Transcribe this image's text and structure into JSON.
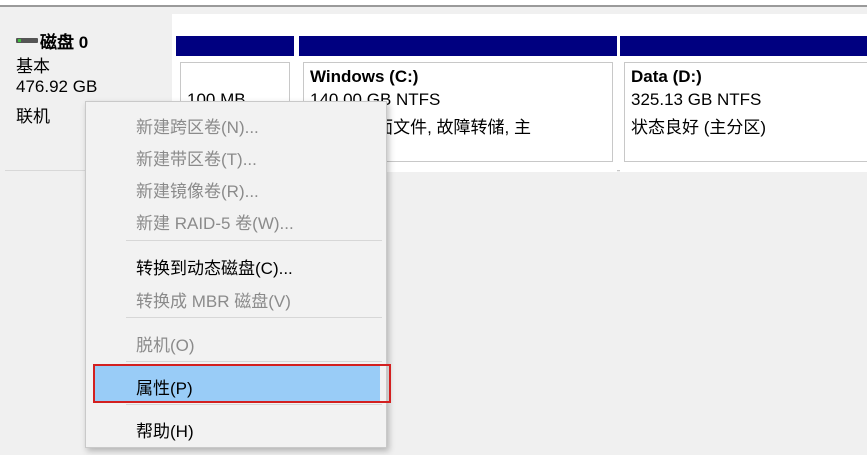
{
  "disk": {
    "title": "磁盘 0",
    "type": "基本",
    "size": "476.92 GB",
    "status": "联机"
  },
  "partitions": [
    {
      "id": "system",
      "size": "100 MB",
      "name": "",
      "fs": "",
      "status": ""
    },
    {
      "id": "windows",
      "name": "Windows  (C:)",
      "fs": "140.00 GB NTFS",
      "status": "(启动, 页面文件, 故障转储, 主"
    },
    {
      "id": "data",
      "name": "Data  (D:)",
      "fs": "325.13 GB NTFS",
      "status": "状态良好 (主分区)"
    }
  ],
  "menu": {
    "items": [
      {
        "label": "新建跨区卷(N)...",
        "enabled": false
      },
      {
        "label": "新建带区卷(T)...",
        "enabled": false
      },
      {
        "label": "新建镜像卷(R)...",
        "enabled": false
      },
      {
        "label": "新建 RAID-5 卷(W)...",
        "enabled": false
      },
      {
        "label": "转换到动态磁盘(C)...",
        "enabled": true
      },
      {
        "label": "转换成 MBR 磁盘(V)",
        "enabled": false
      },
      {
        "label": "脱机(O)",
        "enabled": false
      },
      {
        "label": "属性(P)",
        "enabled": true,
        "highlighted": true
      },
      {
        "label": "帮助(H)",
        "enabled": true
      }
    ]
  },
  "colors": {
    "partition_header": "#000080",
    "menu_highlight": "#99ccf7",
    "annotation_box": "#d32020"
  }
}
